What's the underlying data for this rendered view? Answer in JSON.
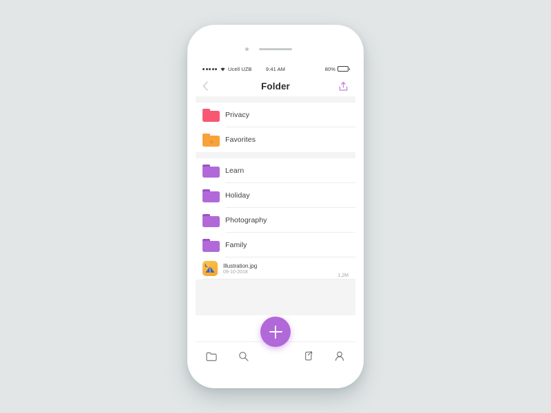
{
  "device": {
    "camera_icon": "camera-dot",
    "speaker_icon": "speaker-grille"
  },
  "status_bar": {
    "signal_icon": "signal-dots",
    "wifi_icon": "wifi-icon",
    "carrier": "Ucell UZB",
    "time": "9:41 AM",
    "battery_percent": "80%",
    "battery_icon": "battery-icon",
    "battery_level": 80
  },
  "nav_bar": {
    "back_icon": "chevron-left-icon",
    "title": "Folder",
    "upload_icon": "upload-icon",
    "upload_color": "#c77fe0"
  },
  "list": {
    "sections": [
      {
        "items": [
          {
            "label": "Privacy",
            "icon": "folder-icon",
            "color": "#f85772",
            "badge": null
          },
          {
            "label": "Favorites",
            "icon": "folder-icon",
            "color": "#f9a13a",
            "badge": "star-icon"
          }
        ]
      },
      {
        "items": [
          {
            "label": "Learn",
            "icon": "folder-icon",
            "color": "#b168d9",
            "badge": null
          },
          {
            "label": "Holiday",
            "icon": "folder-icon",
            "color": "#b168d9",
            "badge": null
          },
          {
            "label": "Photography",
            "icon": "folder-icon",
            "color": "#b168d9",
            "badge": null
          },
          {
            "label": "Family",
            "icon": "folder-icon",
            "color": "#b168d9",
            "badge": null
          }
        ]
      }
    ],
    "file": {
      "thumbnail_icon": "image-thumbnail-icon",
      "name": "Illustration.jpg",
      "date": "09-10-2018",
      "size": "1,2M"
    }
  },
  "fab": {
    "icon": "plus-icon",
    "label": "+",
    "color": "#b168d9"
  },
  "tab_bar": {
    "items": [
      {
        "name": "folder",
        "icon": "folder-outline-icon"
      },
      {
        "name": "search",
        "icon": "search-icon"
      },
      {
        "name": "share",
        "icon": "share-icon"
      },
      {
        "name": "profile",
        "icon": "person-icon"
      }
    ]
  }
}
